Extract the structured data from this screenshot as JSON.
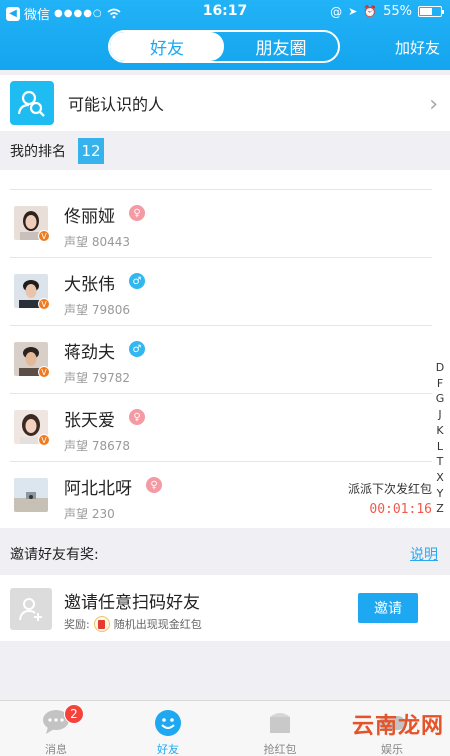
{
  "status_bar": {
    "carrier": "微信",
    "signal": "●●●●○",
    "time": "16:17",
    "battery": "55%"
  },
  "nav": {
    "tabs": [
      "好友",
      "朋友圈"
    ],
    "active_tab": 0,
    "add_friend": "加好友"
  },
  "pymk": {
    "label": "可能认识的人"
  },
  "ranking": {
    "label": "我的排名",
    "rank": "12"
  },
  "friends": [
    {
      "name": "佟丽娅",
      "gender": "female",
      "fame": "声望 80443"
    },
    {
      "name": "大张伟",
      "gender": "male",
      "fame": "声望 79806"
    },
    {
      "name": "蒋劲夫",
      "gender": "male",
      "fame": "声望 79782"
    },
    {
      "name": "张天爱",
      "gender": "female",
      "fame": "声望 78678"
    },
    {
      "name": "阿北北呀",
      "gender": "female",
      "fame": "声望 230",
      "gift_text": "派派下次发红包",
      "countdown": "00:01:16"
    }
  ],
  "alphabet": [
    "D",
    "F",
    "G",
    "J",
    "K",
    "L",
    "T",
    "X",
    "Y",
    "Z"
  ],
  "invite": {
    "section_title": "邀请好友有奖:",
    "explain_link": "说明",
    "title": "邀请任意扫码好友",
    "reward_label": "奖励:",
    "reward_text": "随机出现现金红包",
    "button": "邀请"
  },
  "tabbar": {
    "tabs": [
      {
        "label": "消息",
        "badge": "2"
      },
      {
        "label": "好友"
      },
      {
        "label": "抢红包"
      },
      {
        "label": "娱乐"
      }
    ],
    "active": 1
  },
  "watermark": "云南龙网",
  "colors": {
    "primary": "#1ea8f1",
    "countdown": "#f05a4a",
    "female": "#f39aa3",
    "male": "#33b7f0"
  }
}
